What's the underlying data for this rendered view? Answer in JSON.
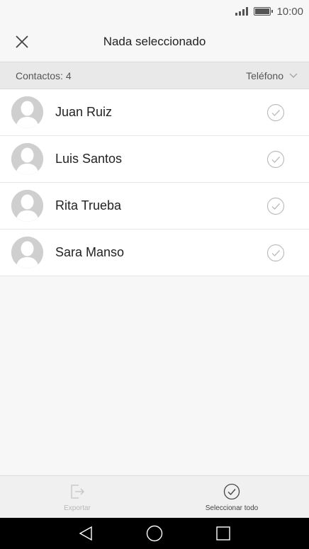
{
  "status_bar": {
    "time": "10:00"
  },
  "header": {
    "title": "Nada seleccionado"
  },
  "filter": {
    "count_label": "Contactos: 4",
    "sort_value": "Teléfono"
  },
  "contacts": [
    {
      "name": "Juan Ruiz",
      "selected": false
    },
    {
      "name": "Luis Santos",
      "selected": false
    },
    {
      "name": "Rita Trueba",
      "selected": false
    },
    {
      "name": "Sara Manso",
      "selected": false
    }
  ],
  "bottom_actions": {
    "export_label": "Exportar",
    "select_all_label": "Seleccionar todo"
  },
  "icons": {
    "close": "close-icon",
    "sort": "chevron-down-icon",
    "avatar": "person-icon",
    "check": "check-circle-icon",
    "export": "export-icon",
    "select_all": "check-circle-icon",
    "back": "back-triangle-icon",
    "home": "home-circle-icon",
    "recents": "recents-square-icon"
  },
  "colors": {
    "background": "#f7f7f7",
    "row_background": "#ffffff",
    "filter_background": "#e9e9e9",
    "nav_bar": "#000000",
    "disabled_text": "#b8b8b8"
  }
}
